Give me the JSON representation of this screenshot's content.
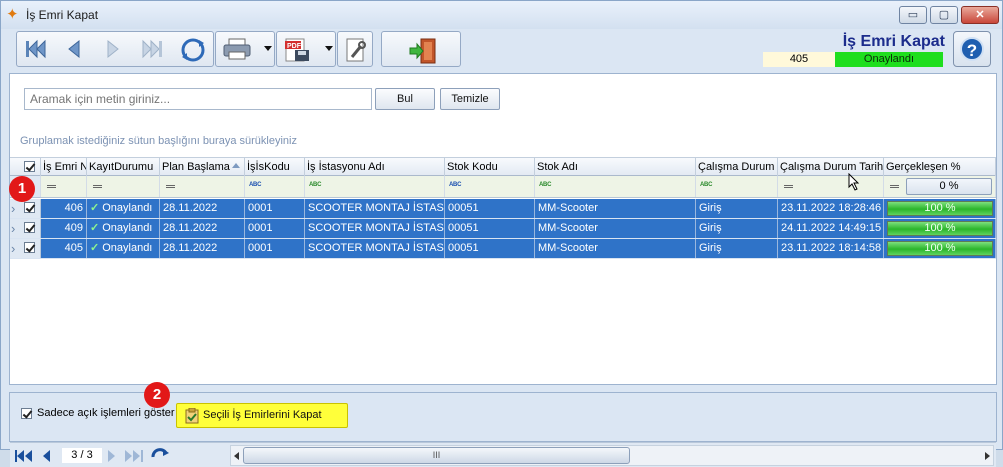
{
  "window": {
    "title": "İş Emri Kapat",
    "minimize_glyph": "▭",
    "maximize_glyph": "▢",
    "close_glyph": "✕"
  },
  "header": {
    "title": "İş Emri Kapat",
    "record_no": "405",
    "status": "Onaylandı",
    "status_color": "#1ede1e",
    "help_glyph": "?"
  },
  "toolbar": {
    "icons": [
      "first-record-icon",
      "previous-record-icon",
      "next-record-icon",
      "last-record-icon",
      "refresh-icon",
      "print-icon",
      "pdf-export-icon",
      "tools-icon",
      "exit-icon"
    ],
    "pdf_label": "PDF"
  },
  "search": {
    "placeholder": "Aramak için metin giriniz...",
    "find_label": "Bul",
    "clear_label": "Temizle"
  },
  "grid": {
    "group_hint": "Gruplamak istediğiniz sütun başlığını buraya sürükleyiniz",
    "columns": [
      "İş Emri N",
      "KayıtDurumu",
      "Plan Başlama",
      "İşİsKodu",
      "İş İstasyonu Adı",
      "Stok Kodu",
      "Stok Adı",
      "Çalışma Durum",
      "Çalışma Durum Tarihi",
      "Gerçekleşen %"
    ],
    "filter_abc": "ABC",
    "percent_filter": "0 %",
    "rows": [
      {
        "no": "406",
        "kayit": "Onaylandı",
        "plan": "28.11.2022",
        "kod": "0001",
        "istasyon": "SCOOTER MONTAJ İSTASYONU",
        "stok_kodu": "00051",
        "stok_adi": "MM-Scooter",
        "durum": "Giriş",
        "tarih": "23.11.2022 18:28:46",
        "yuzde_label": "100 %",
        "yuzde": 1.0
      },
      {
        "no": "409",
        "kayit": "Onaylandı",
        "plan": "28.11.2022",
        "kod": "0001",
        "istasyon": "SCOOTER MONTAJ İSTASYONU",
        "stok_kodu": "00051",
        "stok_adi": "MM-Scooter",
        "durum": "Giriş",
        "tarih": "24.11.2022 14:49:15",
        "yuzde_label": "100 %",
        "yuzde": 1.0
      },
      {
        "no": "405",
        "kayit": "Onaylandı",
        "plan": "28.11.2022",
        "kod": "0001",
        "istasyon": "SCOOTER MONTAJ İSTASYONU",
        "stok_kodu": "00051",
        "stok_adi": "MM-Scooter",
        "durum": "Giriş",
        "tarih": "23.11.2022 18:14:58",
        "yuzde_label": "100 %",
        "yuzde": 1.0
      }
    ],
    "pager": "3 / 3",
    "scroll_grip": "III"
  },
  "footer": {
    "open_only_label": "Sadece açık işlemleri göster",
    "close_selected_label": "Seçili İş Emirlerini Kapat"
  },
  "badges": {
    "first": "1",
    "second": "2"
  },
  "colors": {
    "selection": "#2f73c8",
    "highlight": "#ffff3a",
    "badge": "#e21818"
  }
}
